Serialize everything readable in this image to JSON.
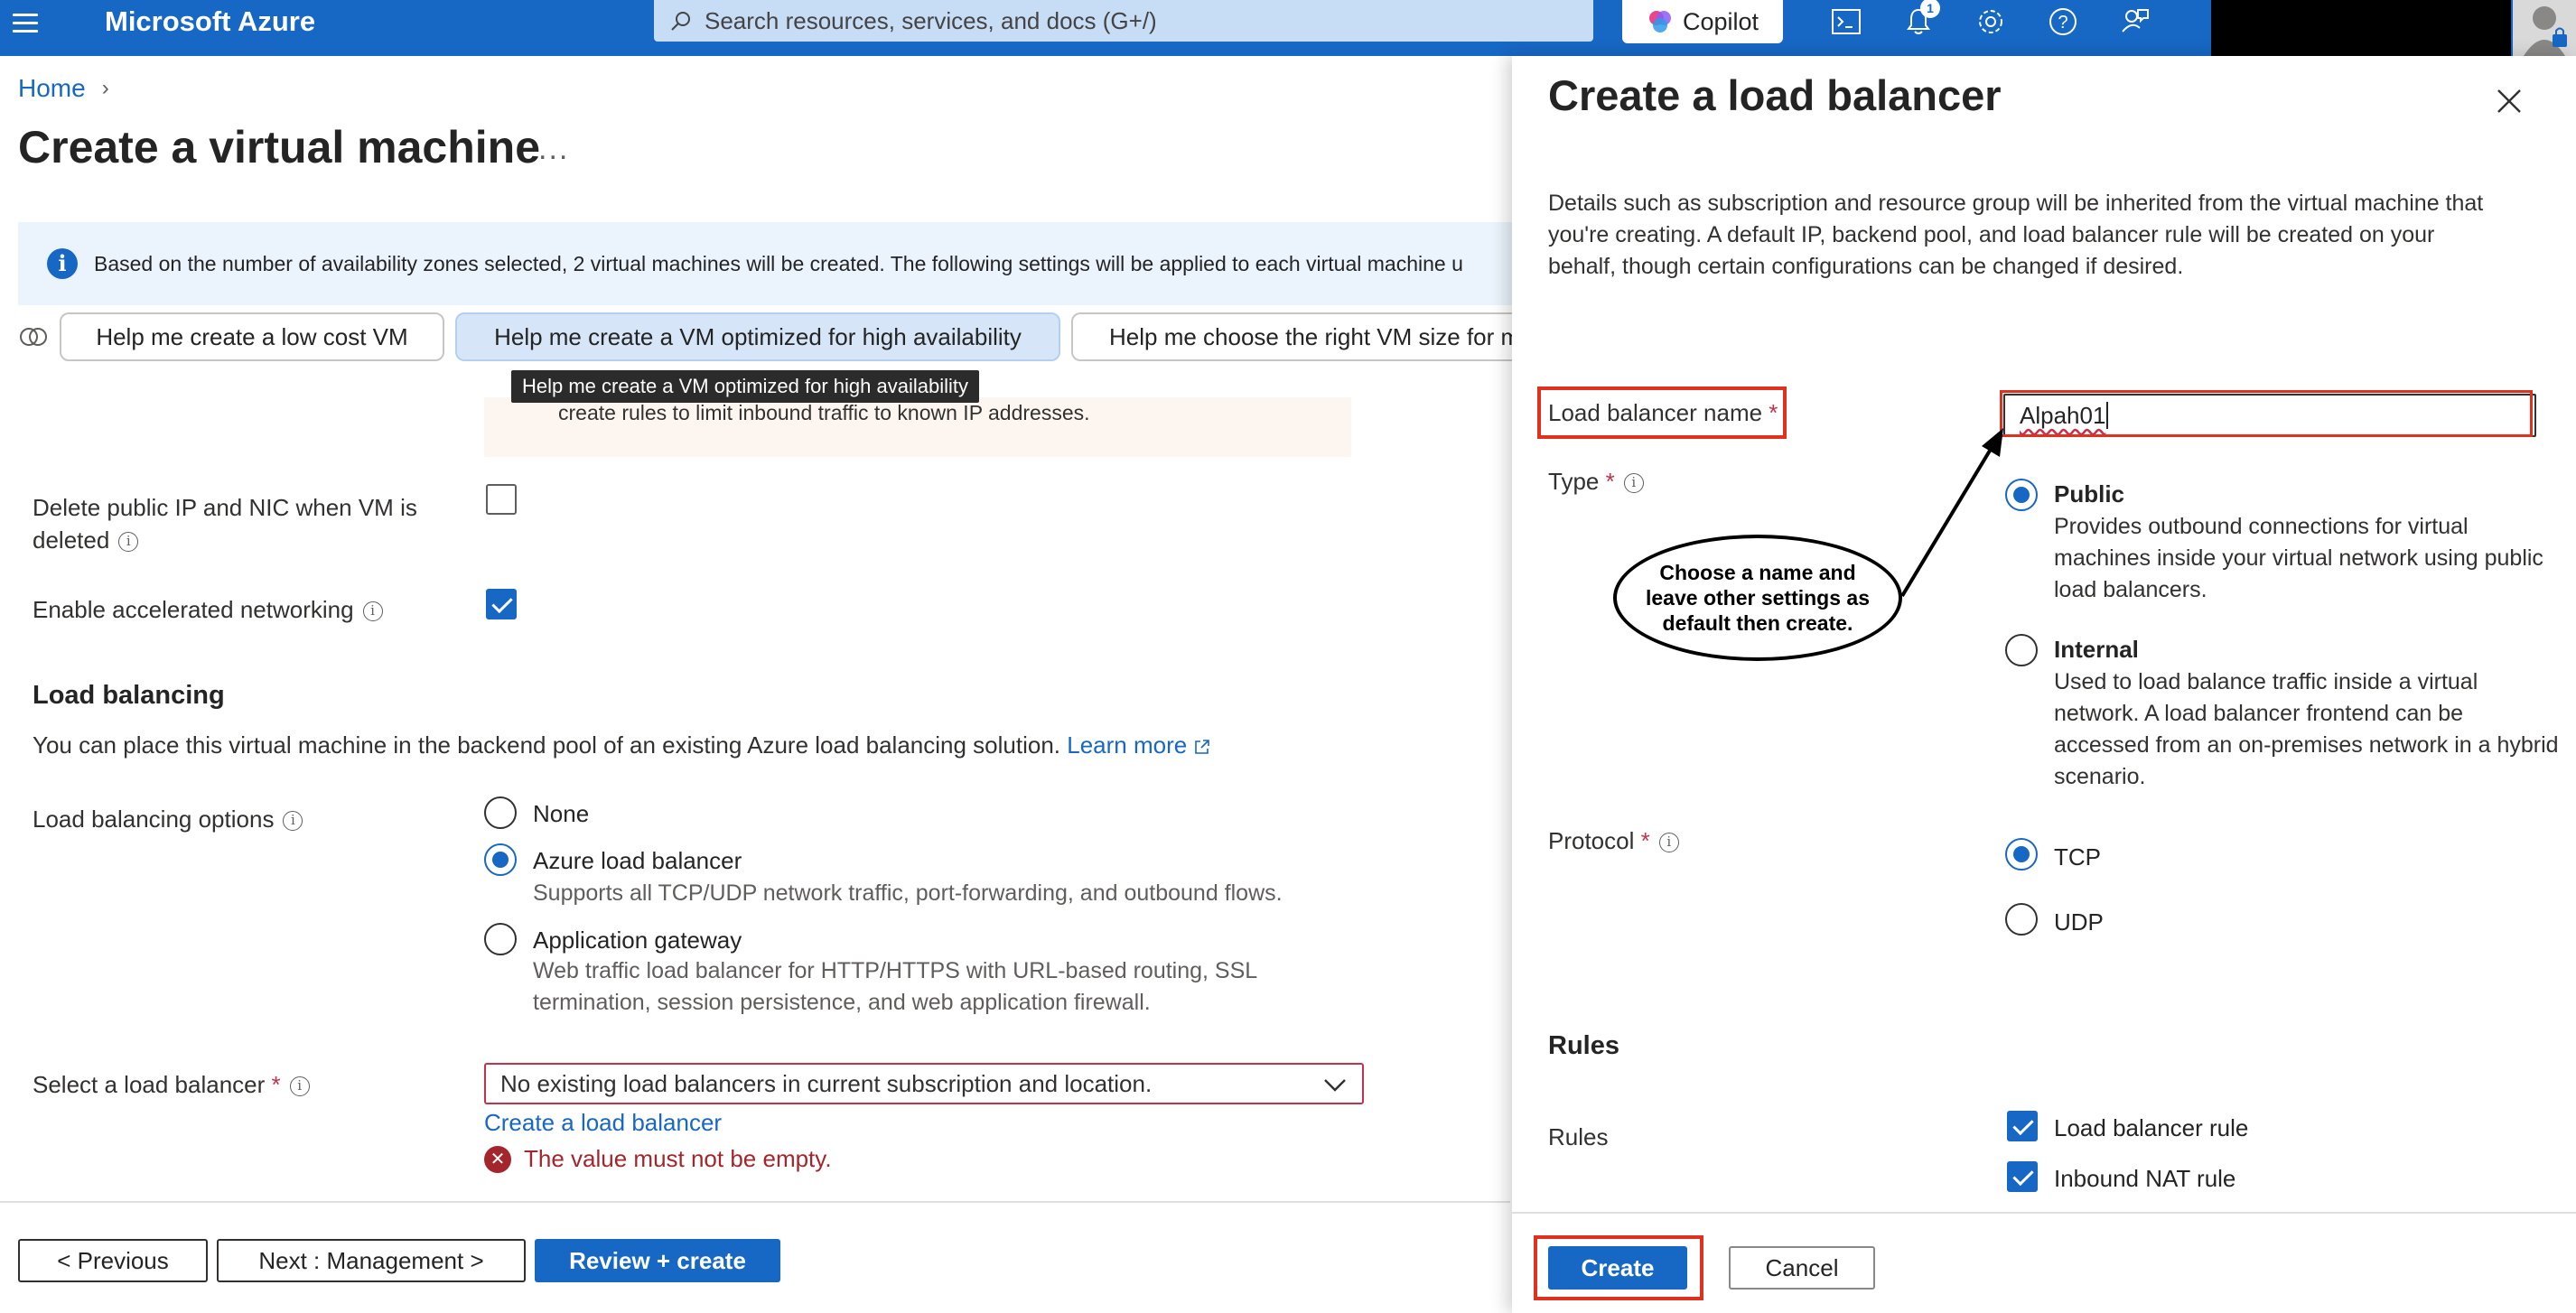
{
  "topbar": {
    "brand": "Microsoft Azure",
    "search_placeholder": "Search resources, services, and docs (G+/)",
    "copilot_label": "Copilot",
    "notification_count": "1"
  },
  "breadcrumb": {
    "home": "Home"
  },
  "page": {
    "title": "Create a virtual machine",
    "more": "...",
    "info_text": "Based on the number of availability zones selected, 2 virtual machines will be created. The following settings will be applied to each virtual machine u",
    "suggestions": [
      "Help me create a low cost VM",
      "Help me create a VM optimized for high availability",
      "Help me choose the right VM size for m"
    ],
    "tooltip": "Help me create a VM optimized for high availability",
    "warning_text": "create rules to limit inbound traffic to known IP addresses.",
    "delete_ip_label_1": "Delete public IP and NIC when VM is",
    "delete_ip_label_2": "deleted",
    "accelerated_label": "Enable accelerated networking",
    "lb_section_title": "Load balancing",
    "lb_section_desc": "You can place this virtual machine in the backend pool of an existing Azure load balancing solution.",
    "learn_more": "Learn more",
    "lb_options_label": "Load balancing options",
    "options": {
      "none": "None",
      "azure": "Azure load balancer",
      "azure_desc": "Supports all TCP/UDP network traffic, port-forwarding, and outbound flows.",
      "gateway": "Application gateway",
      "gateway_desc_1": "Web traffic load balancer for HTTP/HTTPS with URL-based routing, SSL",
      "gateway_desc_2": "termination, session persistence, and web application firewall."
    },
    "select_lb_label": "Select a load balancer",
    "select_lb_value": "No existing load balancers in current subscription and location.",
    "create_lb_link": "Create a load balancer",
    "error_text": "The value must not be empty.",
    "buttons": {
      "previous": "< Previous",
      "next": "Next : Management >",
      "review": "Review + create"
    }
  },
  "panel": {
    "title": "Create a load balancer",
    "description": "Details such as subscription and resource group will be inherited from the virtual machine that you're creating. A default IP, backend pool, and load balancer rule will be created on your behalf, though certain configurations can be changed if desired.",
    "name_label": "Load balancer name",
    "name_value": "Alpah01",
    "type_label": "Type",
    "public_label": "Public",
    "public_desc": "Provides outbound connections for virtual machines inside your virtual network using public load balancers.",
    "internal_label": "Internal",
    "internal_desc": "Used to load balance traffic inside a virtual network. A load balancer frontend can be accessed from an on-premises network in a hybrid scenario.",
    "protocol_label": "Protocol",
    "tcp": "TCP",
    "udp": "UDP",
    "rules_title": "Rules",
    "rules_label": "Rules",
    "lb_rule": "Load balancer rule",
    "nat_rule": "Inbound NAT rule",
    "create": "Create",
    "cancel": "Cancel"
  },
  "annotation": {
    "callout_text": "Choose a name and leave other settings as default then create."
  },
  "colors": {
    "accent": "#1767c4",
    "error": "#a4262c",
    "highlight": "#e0301e"
  }
}
